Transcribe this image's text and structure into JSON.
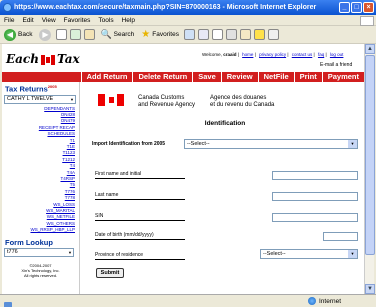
{
  "window": {
    "title": "https://www.eachtax.com/secure/taxmain.php?SIN=870000163 - Microsoft Internet Explorer",
    "minimize": "_",
    "maximize": "□",
    "close": "×"
  },
  "menu": [
    "File",
    "Edit",
    "View",
    "Favorites",
    "Tools",
    "Help"
  ],
  "toolbar": {
    "back": "Back",
    "search": "Search",
    "favorites": "Favorites"
  },
  "site": {
    "logo_left": "Each",
    "logo_right": "Tax",
    "welcome": "Welcome,",
    "username": "craaid",
    "links": [
      "home",
      "privacy policy",
      "contact us",
      "faq",
      "log out"
    ],
    "email_friend": "E-mail a friend"
  },
  "nav": [
    "Add Return",
    "Delete Return",
    "Save",
    "Review",
    "NetFile",
    "Print",
    "Payment"
  ],
  "sidebar": {
    "title": "Tax Returns",
    "year": "2005",
    "selected_return": "CATHY L TWELVE",
    "links": [
      "DEPENDANTS",
      "ON428",
      "ON479",
      "RECEIPT RECAP",
      "SCHEDULES",
      "T1",
      "T1E",
      "T1123",
      "T1212",
      "T4",
      "T4A",
      "T4RSP",
      "T5",
      "T776",
      "T778",
      "WS_LOSS",
      "WS_MARITAL",
      "WS_NETFILE",
      "WS_OTHERS",
      "WS_RRSP_HBP_LLP"
    ],
    "form_lookup_title": "Form Lookup",
    "form_lookup_value": "t776",
    "copyright_lines": [
      "©2004-2007",
      "Xin's Technology, Inc.",
      "All rights reserved."
    ]
  },
  "main": {
    "gov_en_1": "Canada Customs",
    "gov_en_2": "and Revenue Agency",
    "gov_fr_1": "Agence des douanes",
    "gov_fr_2": "et du revenu du Canada",
    "heading": "Identification",
    "import_label": "Import Identification from 2005",
    "import_value": "--Select--",
    "first_name_label": "First name and initial",
    "last_name_label": "Last name",
    "sin_label": "SIN",
    "dob_label": "Date of birth (mm/dd/yyyy)",
    "province_label": "Province of residence",
    "province_value": "--Select--",
    "submit_label": "Submit"
  },
  "status": {
    "left": "",
    "zone": "Internet"
  }
}
